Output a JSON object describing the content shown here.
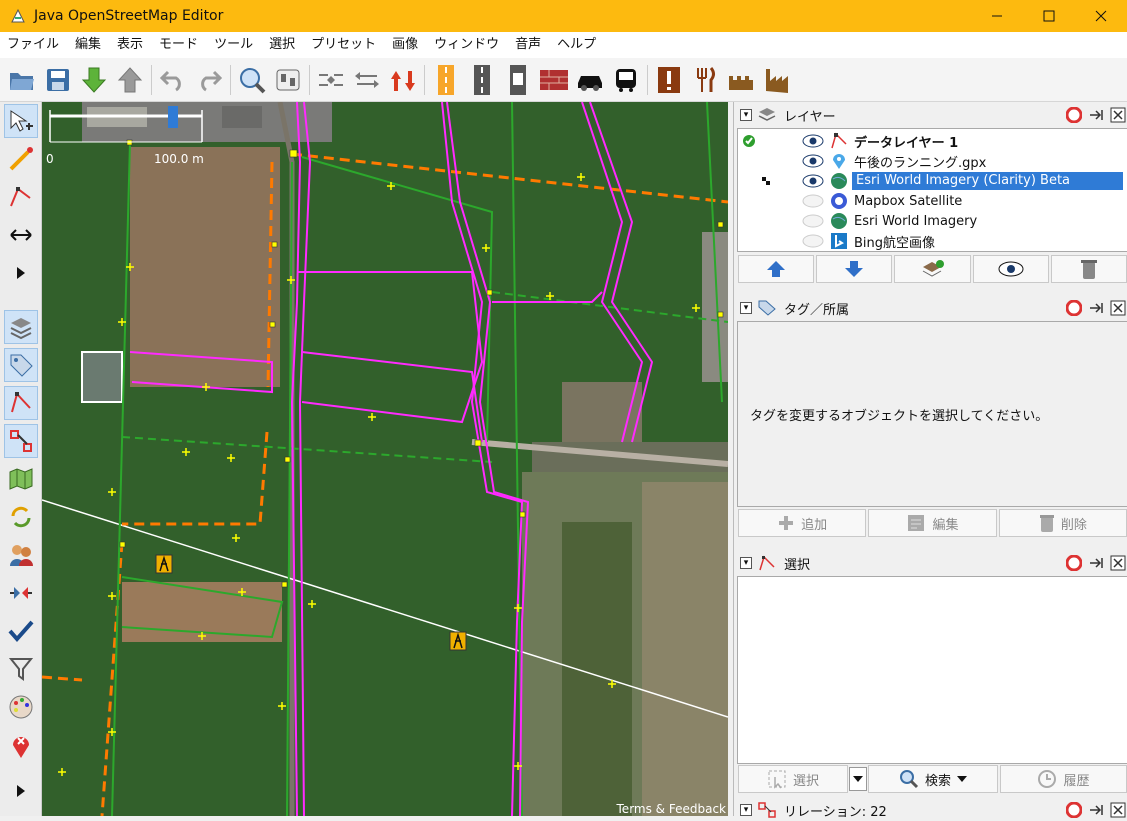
{
  "window": {
    "title": "Java OpenStreetMap Editor"
  },
  "menu": [
    "ファイル",
    "編集",
    "表示",
    "モード",
    "ツール",
    "選択",
    "プリセット",
    "画像",
    "ウィンドウ",
    "音声",
    "ヘルプ"
  ],
  "map": {
    "scale_start": "0",
    "scale_end": "100.0 m",
    "attribution": "Terms & Feedback"
  },
  "layers_panel": {
    "title": "レイヤー",
    "layers": [
      {
        "name": "データレイヤー 1",
        "visible": true,
        "active": true,
        "bold": true
      },
      {
        "name": "午後のランニング.gpx",
        "visible": true
      },
      {
        "name": "Esri World Imagery (Clarity) Beta",
        "visible": true,
        "selected": true
      },
      {
        "name": "Mapbox Satellite",
        "visible": false
      },
      {
        "name": "Esri World Imagery",
        "visible": false
      },
      {
        "name": "Bing航空画像",
        "visible": false
      }
    ]
  },
  "tags_panel": {
    "title": "タグ／所属",
    "empty_message": "タグを変更するオブジェクトを選択してください。",
    "add": "追加",
    "edit": "編集",
    "delete": "削除"
  },
  "selection_panel": {
    "title": "選択",
    "select": "選択",
    "search": "検索",
    "history": "履歴"
  },
  "relation_panel": {
    "title": "リレーション: 22"
  }
}
